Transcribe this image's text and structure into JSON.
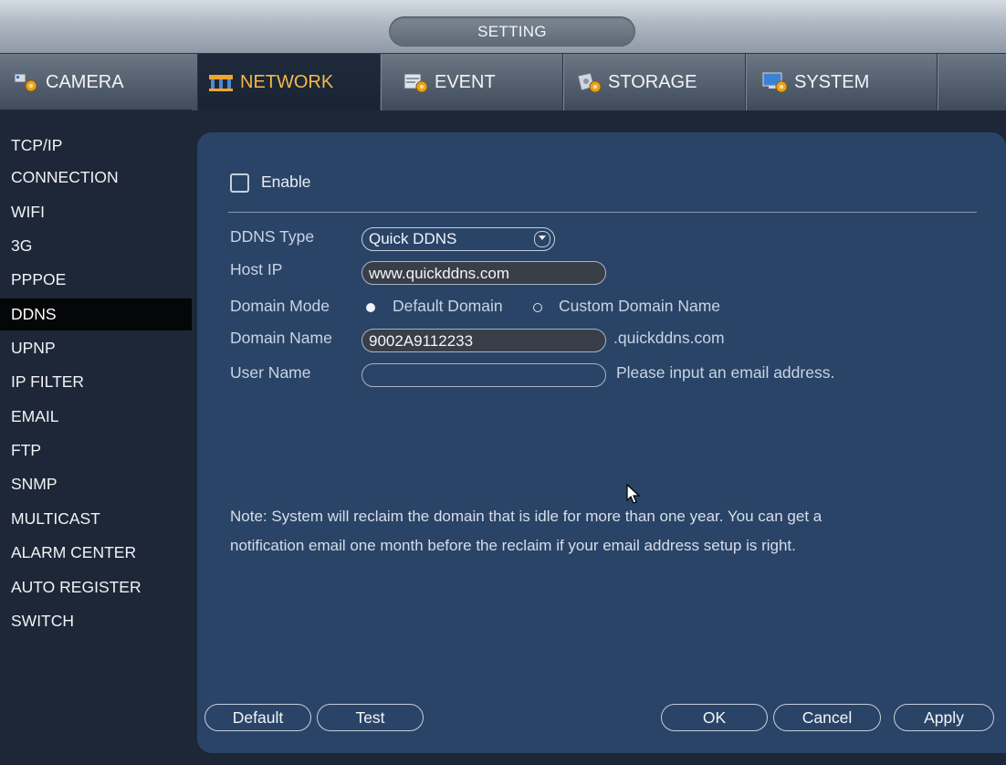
{
  "window": {
    "title": "SETTING"
  },
  "tabs": [
    {
      "label": "CAMERA",
      "icon": "camera-settings-icon",
      "active": false
    },
    {
      "label": "NETWORK",
      "icon": "network-icon",
      "active": true
    },
    {
      "label": "EVENT",
      "icon": "event-icon",
      "active": false
    },
    {
      "label": "STORAGE",
      "icon": "storage-icon",
      "active": false
    },
    {
      "label": "SYSTEM",
      "icon": "system-icon",
      "active": false
    }
  ],
  "sidebar": {
    "items": [
      {
        "label": "TCP/IP"
      },
      {
        "label": "CONNECTION"
      },
      {
        "label": "WIFI"
      },
      {
        "label": "3G"
      },
      {
        "label": "PPPOE"
      },
      {
        "label": "DDNS",
        "active": true
      },
      {
        "label": "UPNP"
      },
      {
        "label": "IP FILTER"
      },
      {
        "label": "EMAIL"
      },
      {
        "label": "FTP"
      },
      {
        "label": "SNMP"
      },
      {
        "label": "MULTICAST"
      },
      {
        "label": "ALARM CENTER"
      },
      {
        "label": "AUTO REGISTER"
      },
      {
        "label": "SWITCH"
      }
    ]
  },
  "form": {
    "enable_label": "Enable",
    "enable_checked": false,
    "ddns_type_label": "DDNS Type",
    "ddns_type_value": "Quick DDNS",
    "host_ip_label": "Host IP",
    "host_ip_value": "www.quickddns.com",
    "domain_mode_label": "Domain Mode",
    "domain_mode_options": [
      "Default Domain",
      "Custom Domain Name"
    ],
    "domain_mode_selected": "Default Domain",
    "domain_name_label": "Domain Name",
    "domain_name_value": "9002A9112233",
    "domain_suffix": ".quickddns.com",
    "user_name_label": "User Name",
    "user_name_value": "",
    "user_name_hint": "Please input an email address.",
    "note_line1": "Note: System will reclaim the domain that is idle for more than one year. You can get a",
    "note_line2": "notification email one month before the reclaim if your email address setup is right."
  },
  "buttons": {
    "default": "Default",
    "test": "Test",
    "ok": "OK",
    "cancel": "Cancel",
    "apply": "Apply"
  },
  "colors": {
    "active_tab_text": "#f7b84a",
    "panel_bg": "#2a4467",
    "app_bg": "#1d2737"
  }
}
